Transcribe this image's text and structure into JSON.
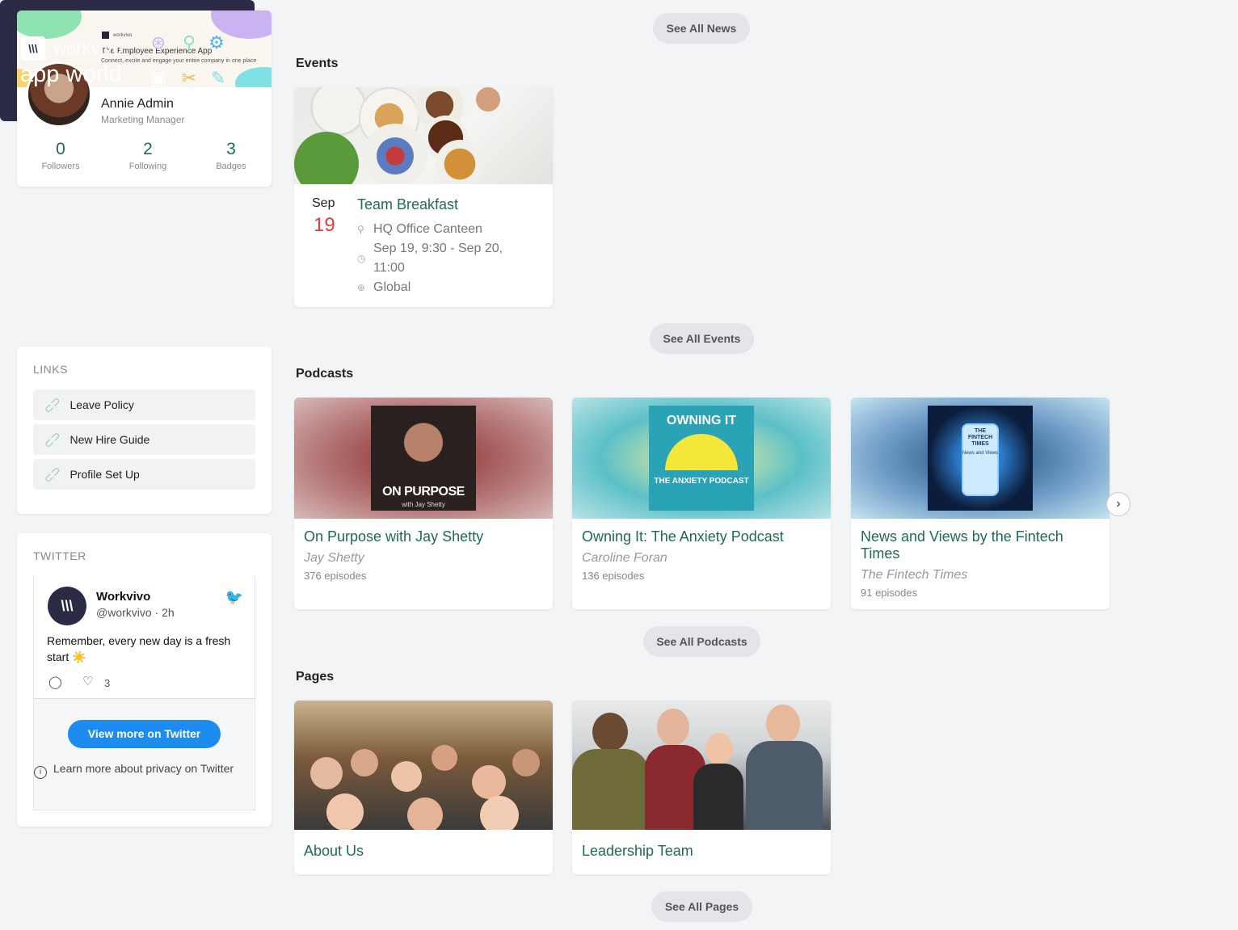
{
  "profile": {
    "banner_brand": "workvivo",
    "banner_title": "The Employee Experience App",
    "banner_subtitle": "Connect, excite and engage your entire company in one place",
    "name": "Annie Admin",
    "role": "Marketing Manager",
    "stats": [
      {
        "value": "0",
        "label": "Followers"
      },
      {
        "value": "2",
        "label": "Following"
      },
      {
        "value": "3",
        "label": "Badges"
      }
    ]
  },
  "appworld": {
    "brand": "workvivo",
    "subtitle": "app world"
  },
  "links": {
    "heading": "LINKS",
    "items": [
      {
        "label": "Leave Policy"
      },
      {
        "label": "New Hire Guide"
      },
      {
        "label": "Profile Set Up"
      }
    ]
  },
  "twitter": {
    "heading": "TWITTER",
    "account_name": "Workvivo",
    "handle": "@workvivo · 2h",
    "text": "Remember, every new day is a fresh start ☀️",
    "like_count": "3",
    "view_more_label": "View more on Twitter",
    "privacy_text": "Learn more about privacy on Twitter"
  },
  "news": {
    "see_all_label": "See All News"
  },
  "events": {
    "title": "Events",
    "see_all_label": "See All Events",
    "items": [
      {
        "month": "Sep",
        "day": "19",
        "title": "Team Breakfast",
        "location": "HQ Office Canteen",
        "time": "Sep 19, 9:30 - Sep 20, 11:00",
        "audience": "Global"
      }
    ]
  },
  "podcasts": {
    "title": "Podcasts",
    "see_all_label": "See All Podcasts",
    "items": [
      {
        "title": "On Purpose with Jay Shetty",
        "author": "Jay Shetty",
        "episodes": "376 episodes",
        "cover_text": "ON PURPOSE",
        "cover_sub": "with Jay Shetty"
      },
      {
        "title": "Owning It: The Anxiety Podcast",
        "author": "Caroline Foran",
        "episodes": "136 episodes",
        "cover_text": "OWNING IT",
        "cover_sub": "THE ANXIETY PODCAST"
      },
      {
        "title": "News and Views by the Fintech Times",
        "author": "The Fintech Times",
        "episodes": "91 episodes",
        "cover_text": "THE FINTECH TIMES",
        "cover_sub": "News and Views"
      }
    ]
  },
  "pages": {
    "title": "Pages",
    "see_all_label": "See All Pages",
    "items": [
      {
        "title": "About Us"
      },
      {
        "title": "Leadership Team"
      }
    ]
  },
  "colors": {
    "accent_green": "#1f6b4f",
    "event_day_red": "#e23b3b",
    "twitter_blue": "#1d8cf0",
    "appworld_bg": "#2c2b45"
  }
}
